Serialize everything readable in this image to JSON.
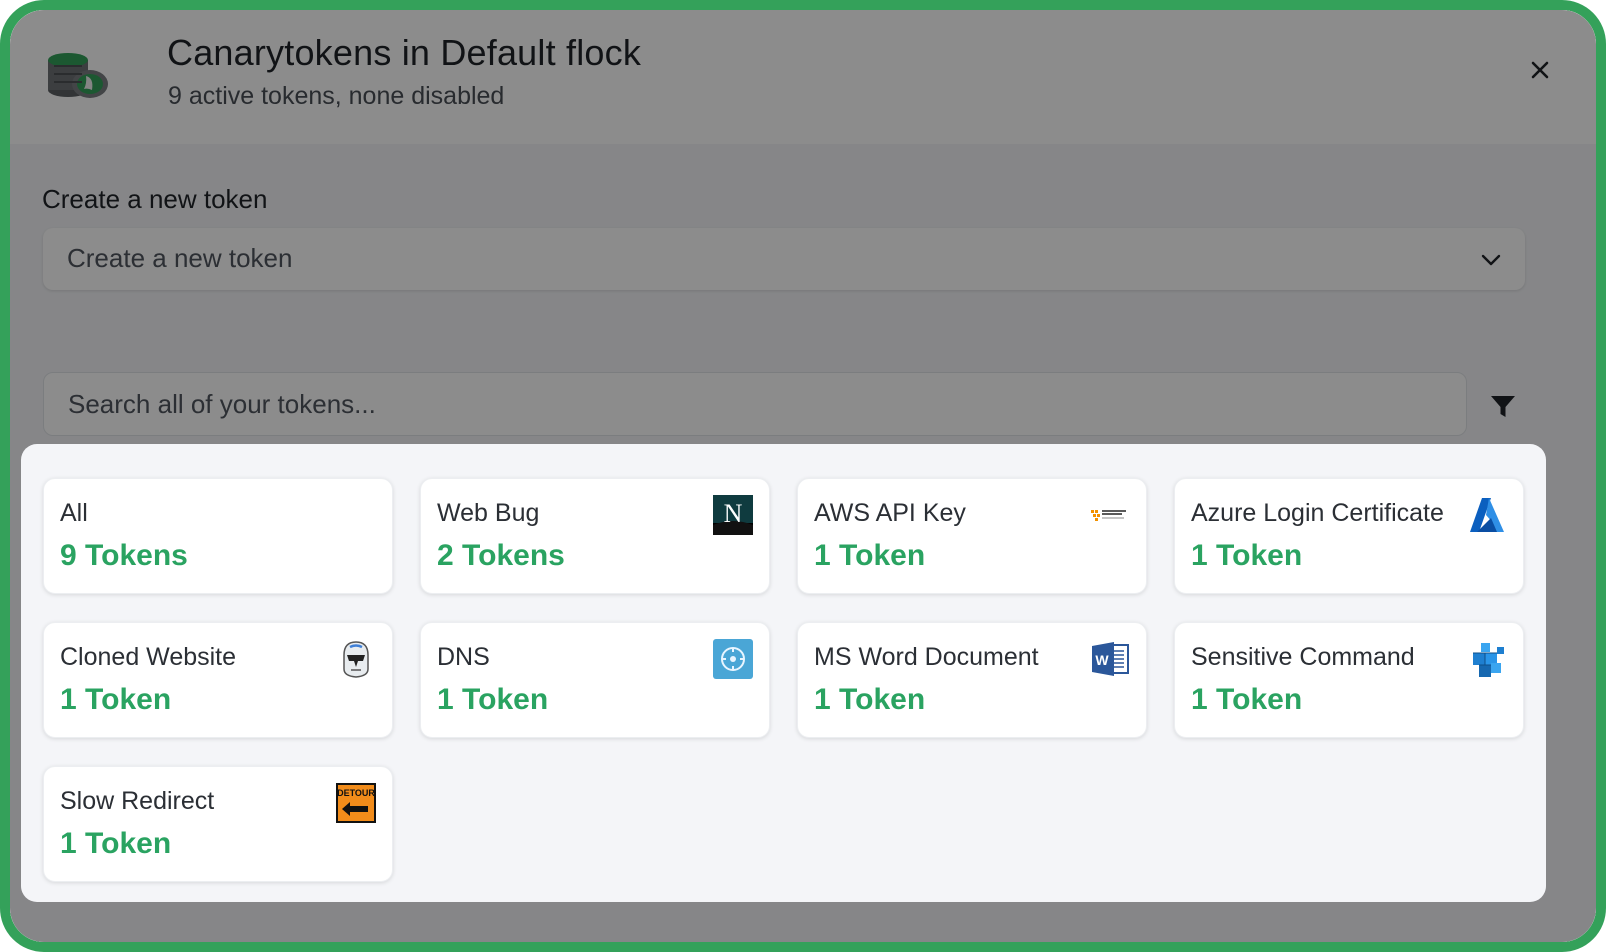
{
  "header": {
    "title": "Canarytokens in Default flock",
    "subtitle": "9 active tokens, none disabled",
    "logo_icon": "canary-flock-logo-icon",
    "close_icon": "close-icon"
  },
  "create": {
    "label": "Create a new token",
    "select_value": "Create a new token",
    "chevron_icon": "chevron-down-icon"
  },
  "search": {
    "placeholder": "Search all of your tokens...",
    "filter_icon": "filter-icon"
  },
  "colors": {
    "frame_border": "#34a15a",
    "count_green": "#2aa361",
    "overlay": "rgba(0,0,0,0.45)"
  },
  "tokens": [
    {
      "name": "All",
      "count": "9 Tokens",
      "icon": null
    },
    {
      "name": "Web Bug",
      "count": "2 Tokens",
      "icon": "netscape-n-icon"
    },
    {
      "name": "AWS API Key",
      "count": "1 Token",
      "icon": "amazon-web-services-icon"
    },
    {
      "name": "Azure Login Certificate",
      "count": "1 Token",
      "icon": "azure-logo-icon"
    },
    {
      "name": "Cloned Website",
      "count": "1 Token",
      "icon": "clone-trooper-icon"
    },
    {
      "name": "DNS",
      "count": "1 Token",
      "icon": "dns-globe-icon"
    },
    {
      "name": "MS Word Document",
      "count": "1 Token",
      "icon": "ms-word-icon"
    },
    {
      "name": "Sensitive Command",
      "count": "1 Token",
      "icon": "sensitive-command-cubes-icon"
    },
    {
      "name": "Slow Redirect",
      "count": "1 Token",
      "icon": "detour-sign-icon",
      "icon_text": "DETOUR"
    }
  ]
}
